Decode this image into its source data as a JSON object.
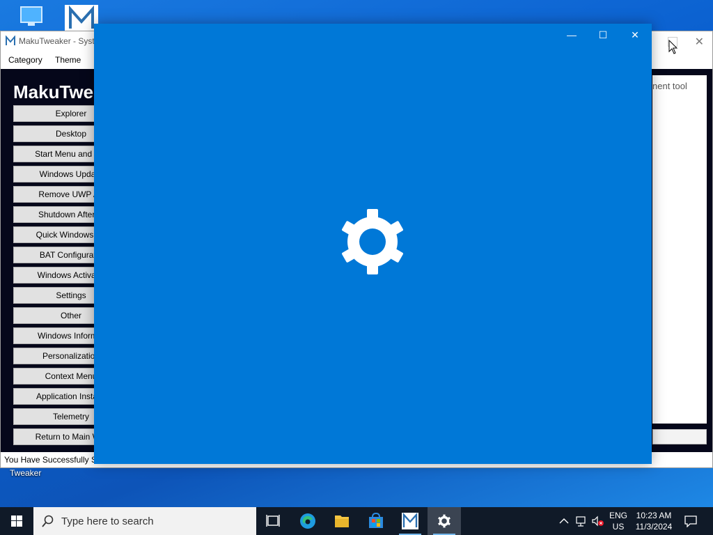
{
  "desktop": {
    "icon_label": "Tweaker"
  },
  "app": {
    "title": "MakuTweaker - Syste",
    "menu": [
      "Category",
      "Theme"
    ],
    "heading": "MakuTwe",
    "categories": [
      "Explorer",
      "Desktop",
      "Start Menu and Tas",
      "Windows Update",
      "Remove UWP Ap",
      "Shutdown After Ti",
      "Quick Windows Se",
      "BAT Configuratio",
      "Windows Activatio",
      "Settings",
      "Other",
      "Windows Informat",
      "Personalization",
      "Context Menu",
      "Application Installa",
      "Telemetry",
      "Return to Main Win"
    ],
    "right_panel_text": "nent tool",
    "status_text": "You Have Successfully Sta"
  },
  "splash": {
    "minimize": "—",
    "maximize": "☐",
    "close": "✕"
  },
  "taskbar": {
    "search_placeholder": "Type here to search",
    "language_top": "ENG",
    "language_bottom": "US",
    "time": "10:23 AM",
    "date": "11/3/2024"
  },
  "colors": {
    "splash_bg": "#0078d7",
    "app_body_bg": "#05071a",
    "taskbar_bg": "#101a28"
  }
}
